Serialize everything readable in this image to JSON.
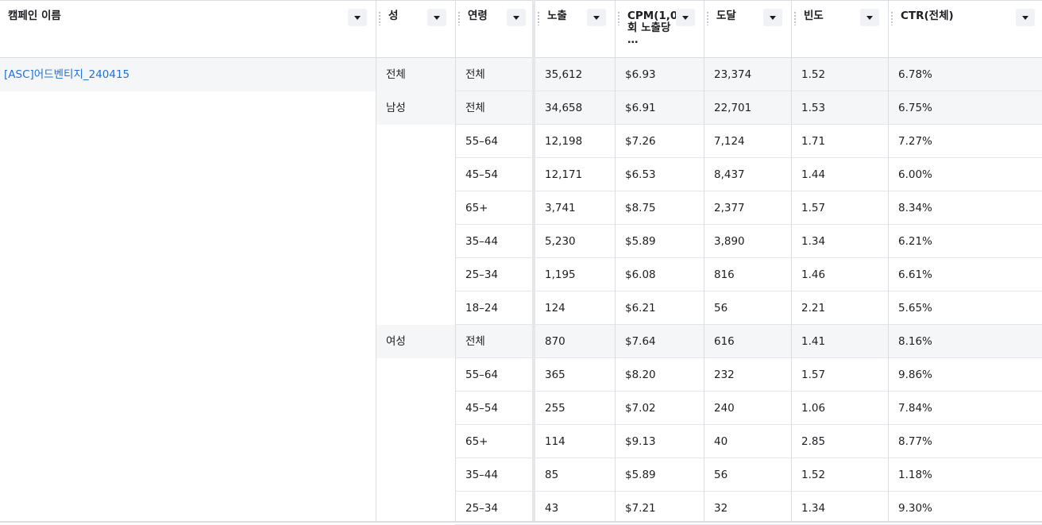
{
  "columns": [
    {
      "key": "campaign",
      "label": "캠페인 이름"
    },
    {
      "key": "gender",
      "label": "성"
    },
    {
      "key": "age",
      "label": "연령"
    },
    {
      "key": "impressions",
      "label": "노출"
    },
    {
      "key": "cpm",
      "label": "CPM(1,000회 노출당 …"
    },
    {
      "key": "reach",
      "label": "도달"
    },
    {
      "key": "frequency",
      "label": "빈도"
    },
    {
      "key": "ctr",
      "label": "CTR(전체)"
    }
  ],
  "campaign": {
    "name": "[ASC]어드벤티지_240415"
  },
  "genders": {
    "all": "전체",
    "male": "남성",
    "female": "여성"
  },
  "rows": [
    {
      "age": "전체",
      "impressions": "35,612",
      "cpm": "$6.93",
      "reach": "23,374",
      "frequency": "1.52",
      "ctr": "6.78%"
    },
    {
      "age": "전체",
      "impressions": "34,658",
      "cpm": "$6.91",
      "reach": "22,701",
      "frequency": "1.53",
      "ctr": "6.75%"
    },
    {
      "age": "55–64",
      "impressions": "12,198",
      "cpm": "$7.26",
      "reach": "7,124",
      "frequency": "1.71",
      "ctr": "7.27%"
    },
    {
      "age": "45–54",
      "impressions": "12,171",
      "cpm": "$6.53",
      "reach": "8,437",
      "frequency": "1.44",
      "ctr": "6.00%"
    },
    {
      "age": "65+",
      "impressions": "3,741",
      "cpm": "$8.75",
      "reach": "2,377",
      "frequency": "1.57",
      "ctr": "8.34%"
    },
    {
      "age": "35–44",
      "impressions": "5,230",
      "cpm": "$5.89",
      "reach": "3,890",
      "frequency": "1.34",
      "ctr": "6.21%"
    },
    {
      "age": "25–34",
      "impressions": "1,195",
      "cpm": "$6.08",
      "reach": "816",
      "frequency": "1.46",
      "ctr": "6.61%"
    },
    {
      "age": "18–24",
      "impressions": "124",
      "cpm": "$6.21",
      "reach": "56",
      "frequency": "2.21",
      "ctr": "5.65%"
    },
    {
      "age": "전체",
      "impressions": "870",
      "cpm": "$7.64",
      "reach": "616",
      "frequency": "1.41",
      "ctr": "8.16%"
    },
    {
      "age": "55–64",
      "impressions": "365",
      "cpm": "$8.20",
      "reach": "232",
      "frequency": "1.57",
      "ctr": "9.86%"
    },
    {
      "age": "45–54",
      "impressions": "255",
      "cpm": "$7.02",
      "reach": "240",
      "frequency": "1.06",
      "ctr": "7.84%"
    },
    {
      "age": "65+",
      "impressions": "114",
      "cpm": "$9.13",
      "reach": "40",
      "frequency": "2.85",
      "ctr": "8.77%"
    },
    {
      "age": "35–44",
      "impressions": "85",
      "cpm": "$5.89",
      "reach": "56",
      "frequency": "1.52",
      "ctr": "1.18%"
    },
    {
      "age": "25–34",
      "impressions": "43",
      "cpm": "$7.21",
      "reach": "32",
      "frequency": "1.34",
      "ctr": "9.30%"
    }
  ],
  "colors": {
    "link": "#216fdb",
    "border": "#dadde1",
    "rowAlt": "#f5f6f7"
  }
}
